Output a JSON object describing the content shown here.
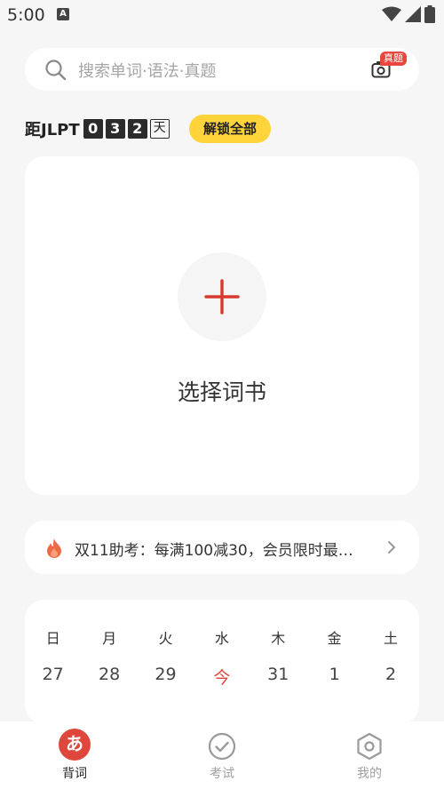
{
  "status": {
    "time": "5:00",
    "app_icon": "A"
  },
  "search": {
    "placeholder": "搜索单词·语法·真题",
    "camera_badge": "真题"
  },
  "countdown": {
    "prefix": "距JLPT",
    "digits": [
      "0",
      "3",
      "2"
    ],
    "unit": "天",
    "unlock_label": "解锁全部"
  },
  "book_card": {
    "choose_label": "选择词书"
  },
  "promo": {
    "text": "双11助考：每满100减30，会员限时最…"
  },
  "calendar": {
    "weekdays": [
      "日",
      "月",
      "火",
      "水",
      "木",
      "金",
      "土"
    ],
    "dates": [
      "27",
      "28",
      "29",
      "今",
      "31",
      "1",
      "2"
    ],
    "today_index": 3
  },
  "nav": {
    "study_icon_char": "あ",
    "study_label": "背词",
    "exam_label": "考试",
    "mine_label": "我的"
  },
  "colors": {
    "accent_red": "#e0473c",
    "unlock_yellow": "#ffd43b",
    "background": "#f6f6f6"
  }
}
